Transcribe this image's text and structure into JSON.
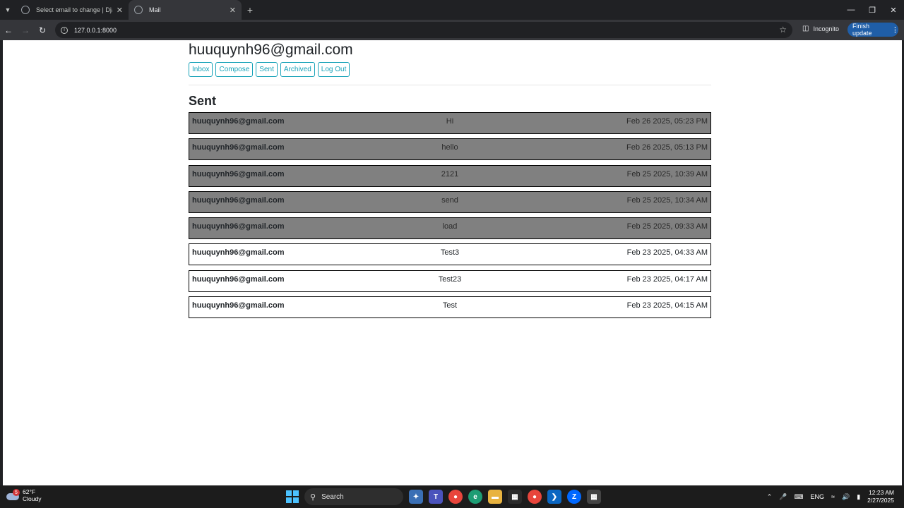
{
  "browser": {
    "tabs": [
      {
        "title": "Select email to change | Djang",
        "active": false
      },
      {
        "title": "Mail",
        "active": true
      }
    ],
    "url": "127.0.0.1:8000",
    "incognito_label": "Incognito",
    "finish_update_label": "Finish update"
  },
  "page": {
    "user_email": "huuquynh96@gmail.com",
    "nav_buttons": [
      "Inbox",
      "Compose",
      "Sent",
      "Archived",
      "Log Out"
    ],
    "mailbox_title": "Sent",
    "emails": [
      {
        "sender": "huuquynh96@gmail.com",
        "subject": "Hi",
        "timestamp": "Feb 26 2025, 05:23 PM",
        "read": true
      },
      {
        "sender": "huuquynh96@gmail.com",
        "subject": "hello",
        "timestamp": "Feb 26 2025, 05:13 PM",
        "read": true
      },
      {
        "sender": "huuquynh96@gmail.com",
        "subject": "2121",
        "timestamp": "Feb 25 2025, 10:39 AM",
        "read": true
      },
      {
        "sender": "huuquynh96@gmail.com",
        "subject": "send",
        "timestamp": "Feb 25 2025, 10:34 AM",
        "read": true
      },
      {
        "sender": "huuquynh96@gmail.com",
        "subject": "load",
        "timestamp": "Feb 25 2025, 09:33 AM",
        "read": true
      },
      {
        "sender": "huuquynh96@gmail.com",
        "subject": "Test3",
        "timestamp": "Feb 23 2025, 04:33 AM",
        "read": false
      },
      {
        "sender": "huuquynh96@gmail.com",
        "subject": "Test23",
        "timestamp": "Feb 23 2025, 04:17 AM",
        "read": false
      },
      {
        "sender": "huuquynh96@gmail.com",
        "subject": "Test",
        "timestamp": "Feb 23 2025, 04:15 AM",
        "read": false
      }
    ]
  },
  "taskbar": {
    "weather_temp": "62°F",
    "weather_desc": "Cloudy",
    "weather_badge": "5",
    "search_label": "Search",
    "tray_lang": "ENG",
    "time": "12:23 AM",
    "date": "2/27/2025"
  },
  "colors": {
    "read_row": "#808080",
    "unread_row": "#ffffff",
    "button_accent": "#17a2b8",
    "update_button": "#1f5ea8"
  }
}
